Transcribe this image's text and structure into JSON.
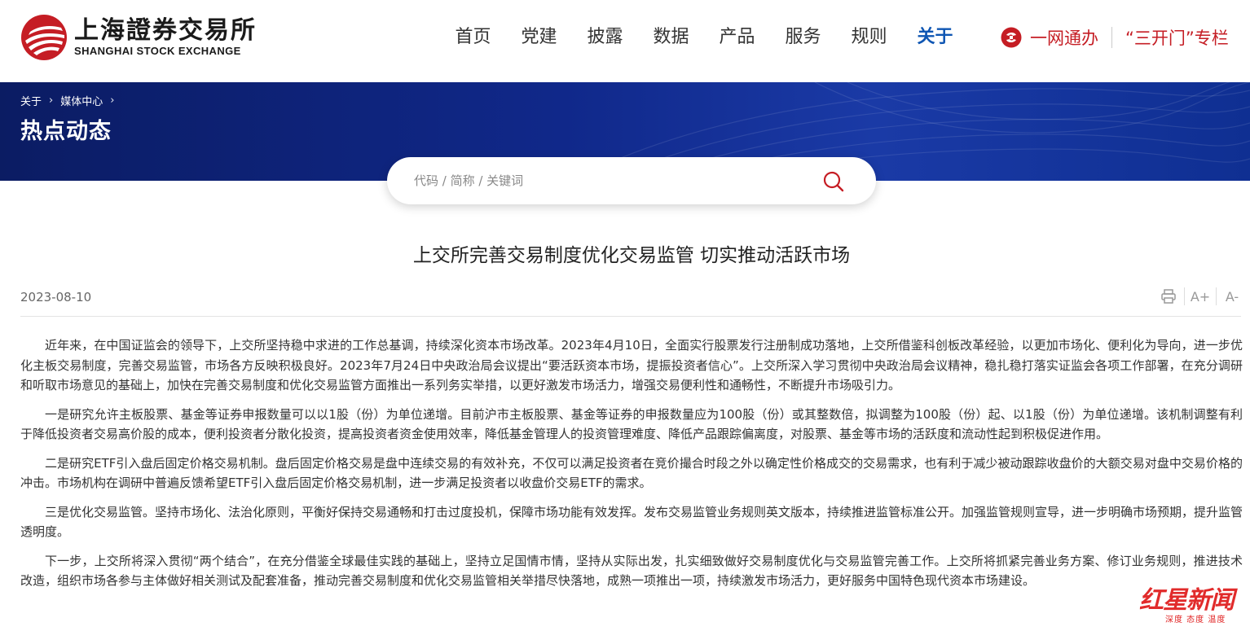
{
  "header": {
    "logo_cn": "上海證券交易所",
    "logo_en": "SHANGHAI STOCK EXCHANGE",
    "nav": [
      "首页",
      "党建",
      "披露",
      "数据",
      "产品",
      "服务",
      "规则",
      "关于"
    ],
    "active_nav": "关于",
    "ywtb_label": "一网通办",
    "skm_label": "“三开门”专栏"
  },
  "banner": {
    "breadcrumb": [
      "关于",
      "媒体中心"
    ],
    "title": "热点动态"
  },
  "search": {
    "placeholder": "代码 / 简称 / 关键词",
    "value": ""
  },
  "article": {
    "title": "上交所完善交易制度优化交易监管 切实推动活跃市场",
    "date": "2023-08-10",
    "tools": {
      "print_icon": "print-icon",
      "font_increase": "A+",
      "font_decrease": "A-"
    },
    "paragraphs": [
      "近年来，在中国证监会的领导下，上交所坚持稳中求进的工作总基调，持续深化资本市场改革。2023年4月10日，全面实行股票发行注册制成功落地，上交所借鉴科创板改革经验，以更加市场化、便利化为导向，进一步优化主板交易制度，完善交易监管，市场各方反映积极良好。2023年7月24日中央政治局会议提出“要活跃资本市场，提振投资者信心”。上交所深入学习贯彻中央政治局会议精神，稳扎稳打落实证监会各项工作部署，在充分调研和听取市场意见的基础上，加快在完善交易制度和优化交易监管方面推出一系列务实举措，以更好激发市场活力，增强交易便利性和通畅性，不断提升市场吸引力。",
      "一是研究允许主板股票、基金等证券申报数量可以以1股（份）为单位递增。目前沪市主板股票、基金等证券的申报数量应为100股（份）或其整数倍，拟调整为100股（份）起、以1股（份）为单位递增。该机制调整有利于降低投资者交易高价股的成本，便利投资者分散化投资，提高投资者资金使用效率，降低基金管理人的投资管理难度、降低产品跟踪偏离度，对股票、基金等市场的活跃度和流动性起到积极促进作用。",
      "二是研究ETF引入盘后固定价格交易机制。盘后固定价格交易是盘中连续交易的有效补充，不仅可以满足投资者在竞价撮合时段之外以确定性价格成交的交易需求，也有利于减少被动跟踪收盘价的大额交易对盘中交易价格的冲击。市场机构在调研中普遍反馈希望ETF引入盘后固定价格交易机制，进一步满足投资者以收盘价交易ETF的需求。",
      "三是优化交易监管。坚持市场化、法治化原则，平衡好保持交易通畅和打击过度投机，保障市场功能有效发挥。发布交易监管业务规则英文版本，持续推进监管标准公开。加强监管规则宣导，进一步明确市场预期，提升监管透明度。",
      "下一步，上交所将深入贯彻“两个结合”，在充分借鉴全球最佳实践的基础上，坚持立足国情市情，坚持从实际出发，扎实细致做好交易制度优化与交易监管完善工作。上交所将抓紧完善业务方案、修订业务规则，推进技术改造，组织市场各参与主体做好相关测试及配套准备，推动完善交易制度和优化交易监管相关举措尽快落地，成熟一项推出一项，持续激发市场活力，更好服务中国特色现代资本市场建设。"
    ]
  },
  "watermark": {
    "main": "红星新闻",
    "sub": "深度 态度 温度"
  },
  "colors": {
    "brand_red": "#c51d24",
    "nav_active": "#0f56b3",
    "banner": "#10288a"
  }
}
